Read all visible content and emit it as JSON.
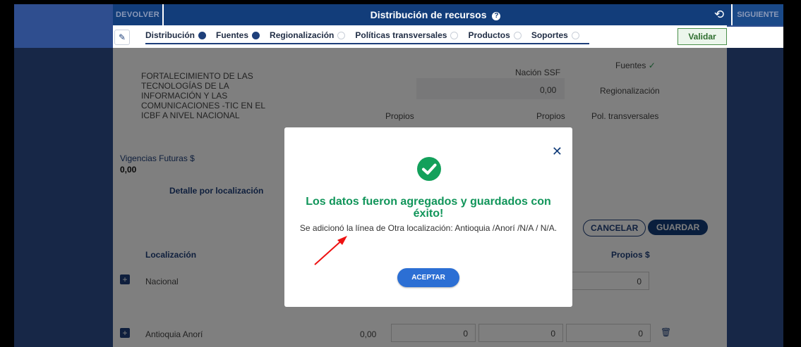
{
  "topbar": {
    "devolver_label": "DEVOLVER",
    "title": "Distribución de recursos",
    "help_icon": "question-circle-icon",
    "undo_icon": "undo-icon",
    "siguiente_label": "SIGUIENTE"
  },
  "tabs": [
    {
      "label": "Distribución",
      "state": "complete"
    },
    {
      "label": "Fuentes",
      "state": "complete"
    },
    {
      "label": "Regionalización",
      "state": "pending"
    },
    {
      "label": "Políticas transversales",
      "state": "pending"
    },
    {
      "label": "Productos",
      "state": "pending"
    },
    {
      "label": "Soportes",
      "state": "pending"
    }
  ],
  "validar_label": "Validar",
  "project": {
    "name_line1": "FORTALECIMIENTO DE LAS",
    "name_line2": "TECNOLOGÍAS DE LA",
    "name_line3": "INFORMACIÓN Y LAS",
    "name_line4": "COMUNICACIONES -TIC EN EL",
    "name_line5": "ICBF A NIVEL  NACIONAL",
    "nacion_ssf_label": "Nación SSF",
    "nacion_ssf_value": "0,00",
    "propios_label_1": "Propios",
    "propios_label_2": "Propios"
  },
  "status_panel": {
    "fuentes": "Fuentes",
    "regionalizacion": "Regionalización",
    "pol_transversales": "Pol. transversales"
  },
  "vigencias": {
    "label": "Vigencias Futuras $",
    "value": "0,00"
  },
  "detalle_label": "Detalle por localización",
  "actions": {
    "cancelar": "CANCELAR",
    "guardar": "GUARDAR"
  },
  "table": {
    "header_localizacion": "Localización",
    "header_propios": "Propios $",
    "rows": [
      {
        "name": "Nacional",
        "propios": "0"
      },
      {
        "name": "Antioquia Anorí",
        "total": "0,00",
        "c1": "0",
        "c2": "0",
        "propios": "0"
      }
    ]
  },
  "modal": {
    "title": "Los datos fueron agregados y guardados con éxito!",
    "message": "Se adicionó la línea de Otra localización: Antioquia /Anorí /N/A / N/A.",
    "accept_label": "ACEPTAR",
    "success_color": "#13a05b"
  }
}
